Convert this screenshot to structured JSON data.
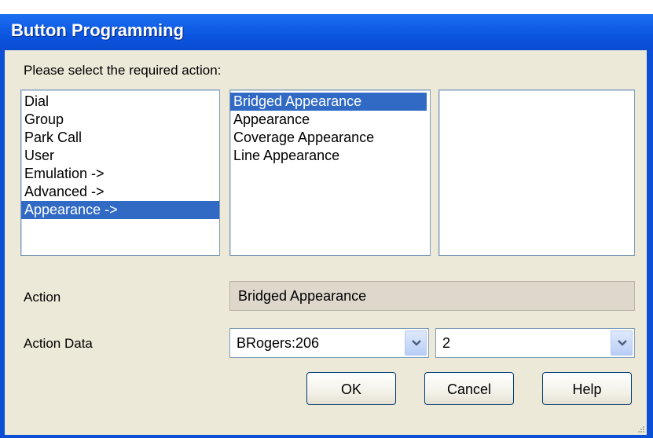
{
  "window": {
    "title": "Button Programming"
  },
  "prompt": "Please select the required action:",
  "lists": {
    "categories": {
      "items": [
        "Dial",
        "Group",
        "Park Call",
        "User",
        "Emulation ->",
        "Advanced ->",
        "Appearance ->"
      ],
      "selected_index": 6
    },
    "actions": {
      "items": [
        "Bridged Appearance",
        "Appearance",
        "Coverage Appearance",
        "Line Appearance"
      ],
      "selected_index": 0
    },
    "subactions": {
      "items": []
    }
  },
  "fields": {
    "action_label": "Action",
    "action_value": "Bridged Appearance",
    "action_data_label": "Action Data",
    "action_data_user": "BRogers:206",
    "action_data_index": "2"
  },
  "buttons": {
    "ok": "OK",
    "cancel": "Cancel",
    "help": "Help"
  },
  "colors": {
    "title_bar": "#0a55e0",
    "selection": "#316ac5",
    "dialog_bg": "#ece9d8"
  }
}
